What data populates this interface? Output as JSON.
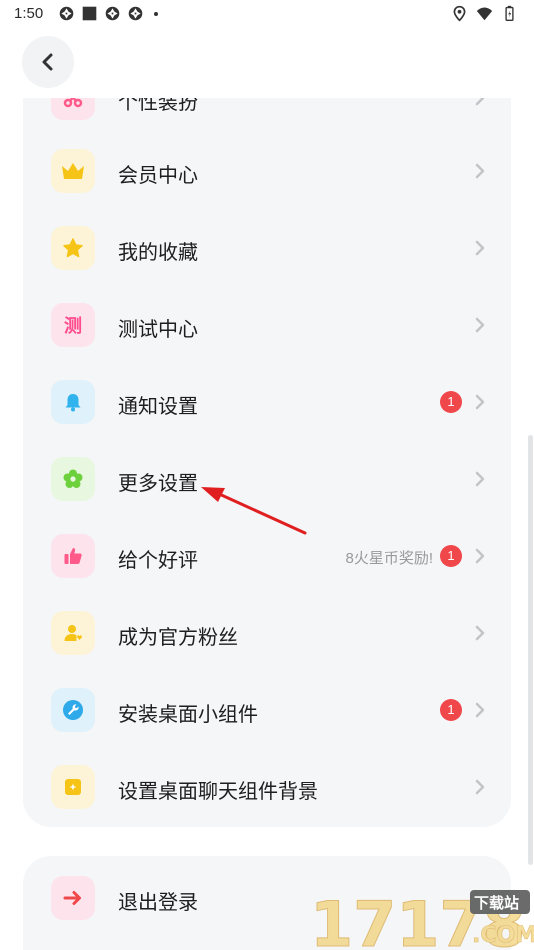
{
  "status_bar": {
    "time": "1:50",
    "left_icons": [
      "aperture-icon",
      "square-icon",
      "aperture-icon",
      "aperture-icon",
      "dot-icon"
    ],
    "right_icons": [
      "location-icon",
      "wifi-icon",
      "battery-icon"
    ]
  },
  "header": {
    "back_icon": "chevron-left-icon"
  },
  "menu": {
    "items": [
      {
        "label": "个性装扮",
        "icon": "scissors-icon",
        "icon_bg": "#fde3ec",
        "icon_color": "#ff5a8a"
      },
      {
        "label": "会员中心",
        "icon": "crown-icon",
        "icon_bg": "#fdf4d8",
        "icon_color": "#f6c417"
      },
      {
        "label": "我的收藏",
        "icon": "star-icon",
        "icon_bg": "#fdf4d8",
        "icon_color": "#f6c417"
      },
      {
        "label": "测试中心",
        "icon": "test-char-icon",
        "icon_glyph": "测",
        "icon_bg": "#fde3ec",
        "icon_color": "#ff4d8d"
      },
      {
        "label": "通知设置",
        "icon": "bell-icon",
        "icon_bg": "#dff1fb",
        "icon_color": "#31b3ee",
        "badge": "1"
      },
      {
        "label": "更多设置",
        "icon": "flower-icon",
        "icon_bg": "#e8f7df",
        "icon_color": "#6cd13d"
      },
      {
        "label": "给个好评",
        "icon": "thumbs-up-icon",
        "icon_bg": "#fde3ec",
        "icon_color": "#ff5a8a",
        "hint": "8火星币奖励!",
        "badge": "1"
      },
      {
        "label": "成为官方粉丝",
        "icon": "fan-user-icon",
        "icon_bg": "#fdf4d8",
        "icon_color": "#f6c417"
      },
      {
        "label": "安装桌面小组件",
        "icon": "wrench-icon",
        "icon_bg": "#dff1fb",
        "icon_color": "#2ea9ea",
        "badge": "1"
      },
      {
        "label": "设置桌面聊天组件背景",
        "icon": "widget-bg-icon",
        "icon_bg": "#fdf4d8",
        "icon_color": "#f6c417"
      }
    ]
  },
  "logout": {
    "label": "退出登录",
    "icon": "arrow-right-icon",
    "icon_bg": "#fde3ec",
    "icon_color": "#f0474b"
  },
  "annotation": {
    "color": "#e02020"
  },
  "watermark": {
    "text": "17178",
    "tag": "下载站",
    "domain": ".COM"
  }
}
